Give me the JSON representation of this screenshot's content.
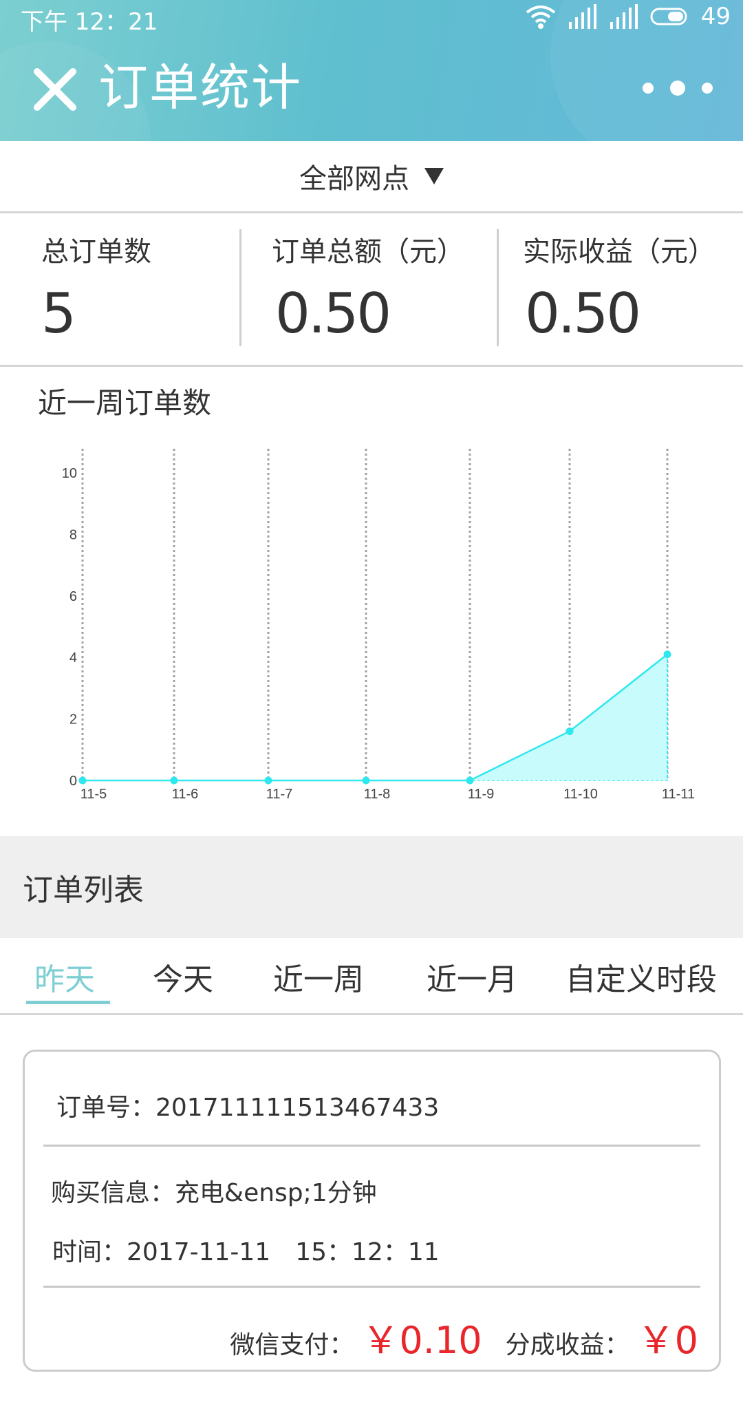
{
  "status_bar": {
    "time": "下午 12：21",
    "battery": "49"
  },
  "header": {
    "title": "订单统计"
  },
  "filter": {
    "label": "全部网点"
  },
  "stats": [
    {
      "label": "总订单数",
      "value": "5"
    },
    {
      "label": "订单总额（元）",
      "value": "0.50"
    },
    {
      "label": "实际收益（元）",
      "value": "0.50"
    }
  ],
  "chart_section": {
    "title": "近一周订单数"
  },
  "chart_data": {
    "type": "area",
    "title": "近一周订单数",
    "categories": [
      "11-5",
      "11-6",
      "11-7",
      "11-8",
      "11-9",
      "11-10",
      "11-11"
    ],
    "values": [
      0,
      0,
      0,
      0,
      0,
      1.6,
      4.1
    ],
    "ylim": [
      0,
      11
    ],
    "y_ticks": [
      "0",
      "2",
      "4",
      "6",
      "8",
      "10"
    ],
    "grid": "vertical dotted",
    "colors": {
      "line": "#2ee8ee",
      "fill": "#c8fbfb",
      "grid": "#a0a0a0"
    }
  },
  "order_list": {
    "title": "订单列表",
    "tabs": [
      "昨天",
      "今天",
      "近一周",
      "近一月",
      "自定义时段"
    ],
    "active_tab": 0
  },
  "order": {
    "order_no": "订单号：201711111513467433",
    "buy_info": "购买信息：充电&ensp;1分钟",
    "time": "时间：2017-11-11　15：12：11",
    "wechat_pay_label": "微信支付：",
    "wechat_pay_amount": "￥0.10",
    "share_label": "分成收益：",
    "share_amount": "￥0"
  },
  "colors": {
    "header": "#63c0cf",
    "accent": "#7ecfd3",
    "price": "#e8262b"
  }
}
